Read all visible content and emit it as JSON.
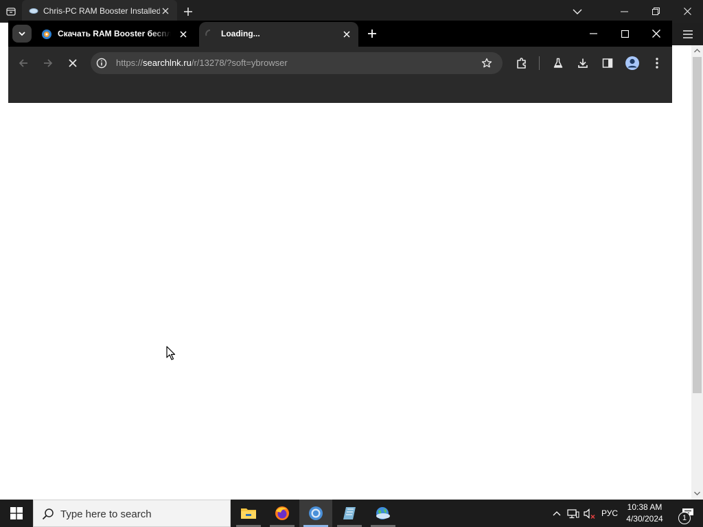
{
  "outer_window": {
    "tab_title": "Chris-PC RAM Booster Installed",
    "icons": {
      "tab_actions": "tab-actions-icon",
      "new_tab": "plus-icon",
      "tab_list": "chevron-down-icon",
      "minimize": "minimize-icon",
      "restore": "restore-icon",
      "close": "close-icon",
      "menu": "hamburger-icon"
    }
  },
  "chrome": {
    "tabs": [
      {
        "title": "Скачать RAM Booster бесплатно",
        "state": "inactive"
      },
      {
        "title": "Loading...",
        "state": "active"
      }
    ],
    "address": {
      "scheme": "https://",
      "host": "searchlnk.ru",
      "path": "/r/13278/?soft=ybrowser"
    },
    "toolbar_icons": [
      "back-icon",
      "forward-icon",
      "stop-icon",
      "info-icon",
      "star-icon",
      "extensions-icon",
      "labs-icon",
      "download-icon",
      "side-panel-icon",
      "profile-icon",
      "more-icon"
    ]
  },
  "taskbar": {
    "search_placeholder": "Type here to search",
    "apps": [
      "file-explorer-icon",
      "firefox-icon",
      "chrome-icon",
      "notepad-icon",
      "browser-globe-icon"
    ],
    "language": "РУС",
    "time": "10:38 AM",
    "date": "4/30/2024",
    "notification_count": "1"
  },
  "colors": {
    "outer_bar": "#202020",
    "chrome_tabstrip": "#000000",
    "chrome_toolbar": "#2a2a2a",
    "taskbar": "#1c1c1c",
    "active_indicator": "#8fb7e8"
  }
}
